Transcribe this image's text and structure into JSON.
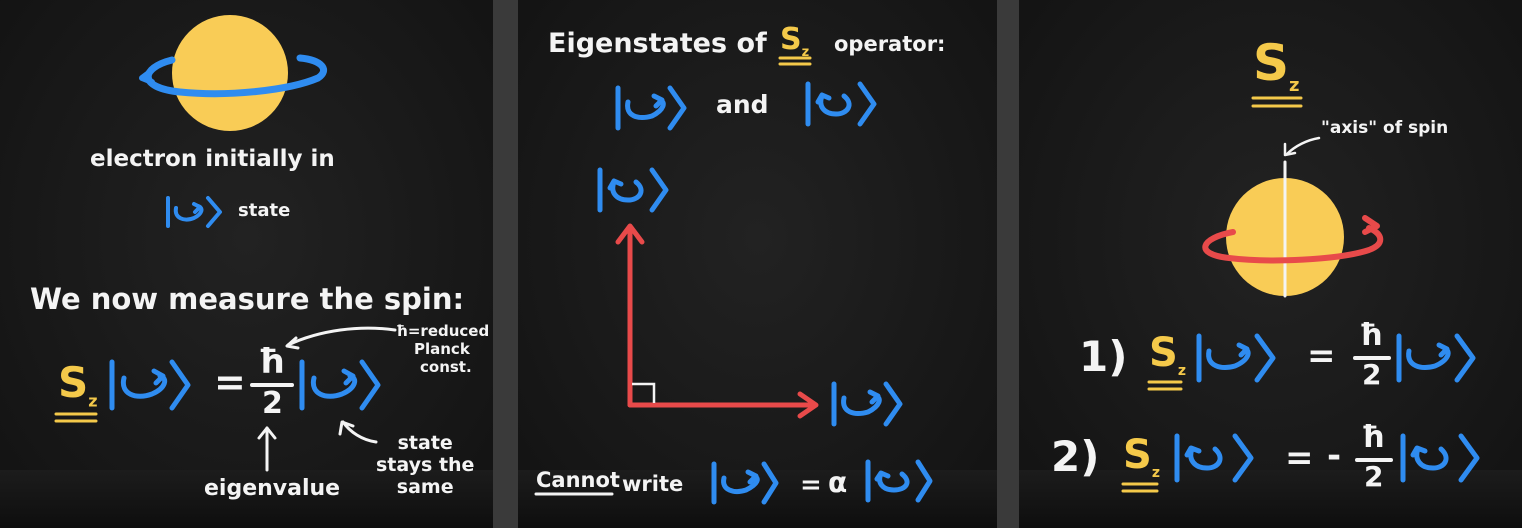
{
  "colors": {
    "ball": "#f9cc56",
    "blue": "#2f8cf0",
    "red": "#e84a4a",
    "white": "#f4f4f4",
    "yellow": "#f4c94a"
  },
  "panel1": {
    "caption_line1": "electron initially in",
    "caption_state": "state",
    "measure_title": "We now measure the spin:",
    "operator": "S",
    "operator_sub": "z",
    "equals": "=",
    "hbar": "ħ",
    "two": "2",
    "hbar_note": "ħ=reduced Planck const.",
    "hbar_note_line1": "ħ=reduced",
    "hbar_note_line2": "Planck",
    "hbar_note_line3": "const.",
    "eigenvalue_label": "eigenvalue",
    "state_note_line1": "state",
    "state_note_line2": "stays the",
    "state_note_line3": "same"
  },
  "panel2": {
    "title_prefix": "Eigenstates of",
    "operator": "S",
    "operator_sub": "z",
    "title_suffix": "operator:",
    "and": "and",
    "cannot": "Cannot",
    "write": "write",
    "equals": "=",
    "alpha": "α"
  },
  "panel3": {
    "operator": "S",
    "operator_sub": "z",
    "axis_label": "\"axis\" of spin",
    "eq1_number": "1)",
    "eq2_number": "2)",
    "equals": "=",
    "minus": "-",
    "hbar": "ħ",
    "two": "2"
  }
}
